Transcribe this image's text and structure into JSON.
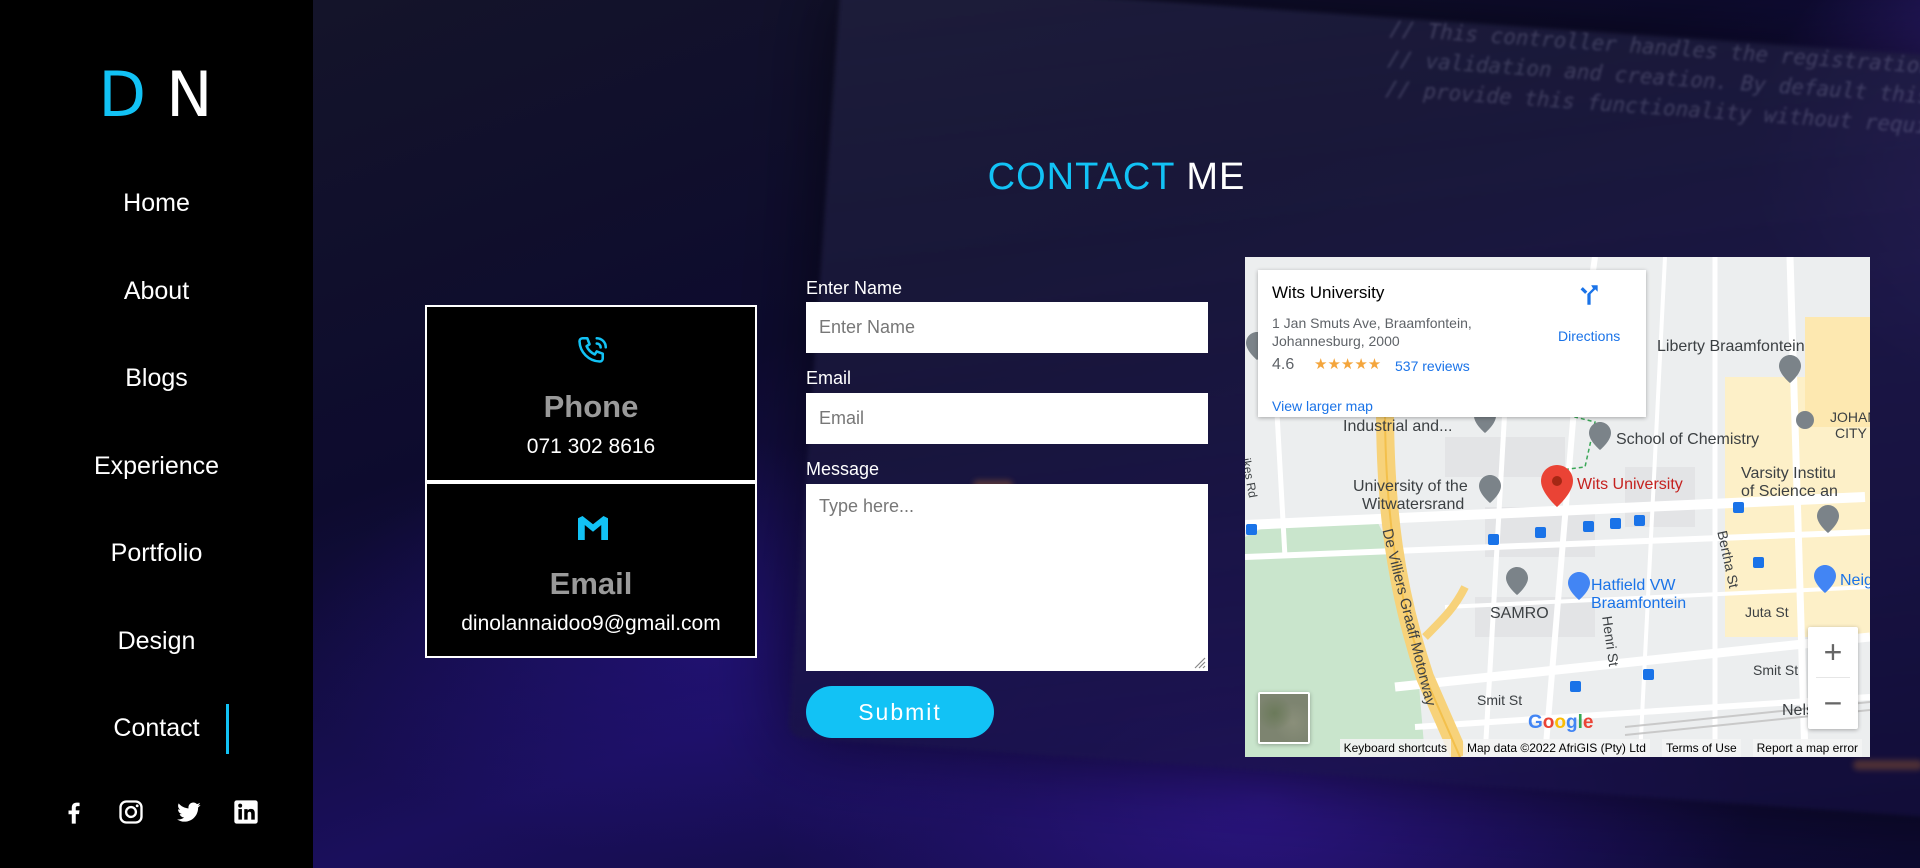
{
  "logo": {
    "first": "D",
    "second": "N"
  },
  "nav": {
    "items": [
      {
        "label": "Home"
      },
      {
        "label": "About"
      },
      {
        "label": "Blogs"
      },
      {
        "label": "Experience"
      },
      {
        "label": "Portfolio"
      },
      {
        "label": "Design"
      },
      {
        "label": "Contact",
        "active": true
      }
    ]
  },
  "socials": [
    "facebook-icon",
    "instagram-icon",
    "twitter-icon",
    "linkedin-icon"
  ],
  "title": {
    "accent": "CONTACT",
    "rest": "ME"
  },
  "cards": {
    "phone": {
      "icon": "phone-icon",
      "title": "Phone",
      "value": "071 302 8616"
    },
    "email": {
      "icon": "gmail-icon",
      "title": "Email",
      "value": "dinolannaidoo9@gmail.com"
    }
  },
  "form": {
    "name_label": "Enter Name",
    "name_placeholder": "Enter Name",
    "email_label": "Email",
    "email_placeholder": "Email",
    "message_label": "Message",
    "message_placeholder": "Type here...",
    "submit_label": "Submit"
  },
  "map": {
    "place": {
      "name": "Wits University",
      "address": "1 Jan Smuts Ave, Braamfontein, Johannesburg, 2000",
      "rating": "4.6",
      "stars": "★★★★★",
      "reviews": "537 reviews",
      "larger_map": "View larger map",
      "directions": "Directions"
    },
    "labels": {
      "liberty": "Liberty Braamfontein",
      "chemistry": "School of Chemistry",
      "johan": "JOHAN",
      "city": "CITY C",
      "industrial": "Industrial and...",
      "uni_wits_1": "University of the",
      "uni_wits_2": "Witwatersrand",
      "wits_pin": "Wits University",
      "varsity_1": "Varsity Institu",
      "varsity_2": "of Science an",
      "de_villiers": "De Villiers Graaff Motorway",
      "bertha": "Bertha St",
      "hatfield_1": "Hatfield VW",
      "hatfield_2": "Braamfontein",
      "neig": "Neig",
      "samro": "SAMRO",
      "henri": "Henri St",
      "juta": "Juta St",
      "smit1": "Smit St",
      "smit2": "Smit St",
      "nelson": "Nelson M",
      "sikes": "ikes Rd"
    },
    "google": "Google",
    "attribution": {
      "shortcuts": "Keyboard shortcuts",
      "data": "Map data ©2022 AfriGIS (Pty) Ltd",
      "terms": "Terms of Use",
      "report": "Report a map error"
    },
    "zoom_in": "+",
    "zoom_out": "−"
  },
  "colors": {
    "accent": "#12c2f5",
    "sidebar_bg": "#000000",
    "card_title": "#9a9a9a"
  }
}
